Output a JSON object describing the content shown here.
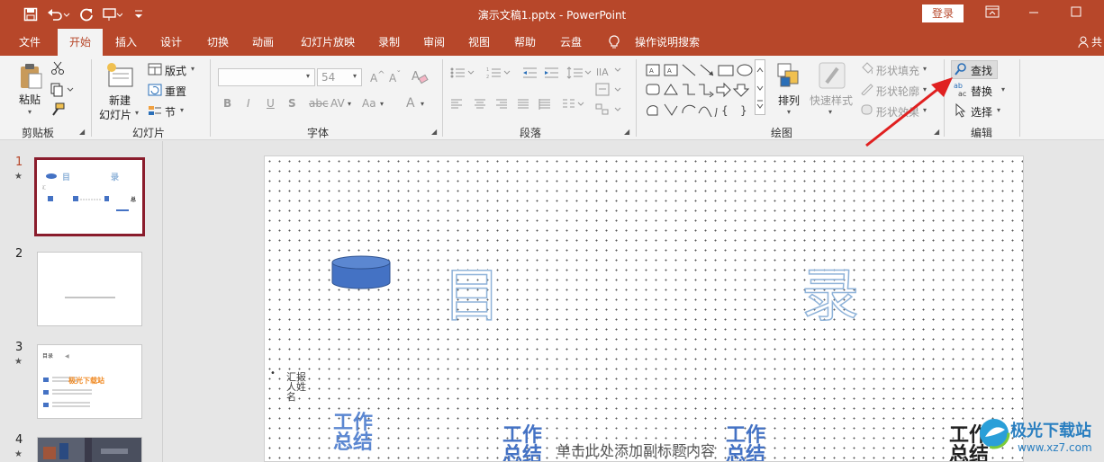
{
  "title_bar": {
    "document_title": "演示文稿1.pptx  -  PowerPoint",
    "login_label": "登录",
    "qat_icons": [
      "save-icon",
      "undo-icon",
      "redo-icon",
      "presentation-icon",
      "customize-icon"
    ]
  },
  "menu_tabs": [
    {
      "label": "文件"
    },
    {
      "label": "开始",
      "active": true
    },
    {
      "label": "插入"
    },
    {
      "label": "设计"
    },
    {
      "label": "切换"
    },
    {
      "label": "动画"
    },
    {
      "label": "幻灯片放映"
    },
    {
      "label": "录制"
    },
    {
      "label": "审阅"
    },
    {
      "label": "视图"
    },
    {
      "label": "帮助"
    },
    {
      "label": "云盘"
    },
    {
      "label": "操作说明搜索"
    },
    {
      "label": "共"
    }
  ],
  "ribbon": {
    "clipboard": {
      "paste": "粘贴",
      "group": "剪贴板"
    },
    "slides": {
      "new_slide": "新建",
      "new_slide_2": "幻灯片",
      "layout": "版式",
      "reset": "重置",
      "section": "节",
      "group": "幻灯片"
    },
    "font": {
      "size": "54",
      "group": "字体",
      "buttons": [
        "B",
        "I",
        "U",
        "S",
        "AV",
        "Aa",
        "A"
      ]
    },
    "paragraph": {
      "group": "段落"
    },
    "drawing": {
      "arrange": "排列",
      "quick_styles": "快速样式",
      "shape_fill": "形状填充",
      "shape_outline": "形状轮廓",
      "shape_effects": "形状效果",
      "group": "绘图"
    },
    "editing": {
      "find": "查找",
      "replace": "替换",
      "select": "选择",
      "group": "编辑"
    }
  },
  "thumbnails": [
    {
      "number": "1",
      "star": "★",
      "selected": true
    },
    {
      "number": "2",
      "star": ""
    },
    {
      "number": "3",
      "star": "★"
    },
    {
      "number": "4",
      "star": "★"
    }
  ],
  "thumb3": {
    "title": "目录",
    "watermark": "极光下载站"
  },
  "slide": {
    "char_left": "目",
    "char_right": "录",
    "reporter": "汇报人姓名",
    "bullet": "•",
    "wordart_1": "工作总结",
    "wordart_2": "工作总结",
    "wordart_3": "工作总结",
    "wordart_4": "工作总结",
    "subtitle_placeholder": "单击此处添加副标题内容"
  },
  "watermark": {
    "brand": "极光下载站",
    "url": "www.xz7.com"
  },
  "colors": {
    "brand": "#b7472a",
    "accent_blue": "#4472c4",
    "selection": "#8a1c2c",
    "annotation_arrow": "#e02020"
  }
}
